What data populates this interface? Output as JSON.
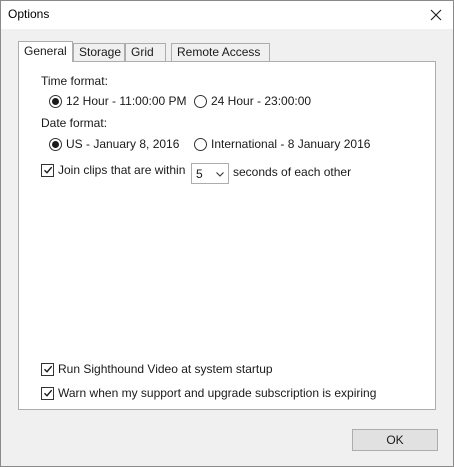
{
  "window": {
    "title": "Options"
  },
  "tabs": [
    {
      "label": "General",
      "active": true
    },
    {
      "label": "Storage",
      "active": false
    },
    {
      "label": "Grid",
      "active": false
    },
    {
      "label": "Remote Access",
      "active": false
    }
  ],
  "general": {
    "time_format": {
      "label": "Time format:",
      "options": [
        {
          "label": "12 Hour - 11:00:00 PM",
          "selected": true
        },
        {
          "label": "24 Hour - 23:00:00",
          "selected": false
        }
      ]
    },
    "date_format": {
      "label": "Date format:",
      "options": [
        {
          "label": "US - January 8, 2016",
          "selected": true
        },
        {
          "label": "International - 8 January 2016",
          "selected": false
        }
      ]
    },
    "join_clips": {
      "label_before": "Join clips that are within",
      "checked": true,
      "seconds_value": "5",
      "label_after": "seconds of each other"
    },
    "startup": {
      "label": "Run Sighthound Video at system startup",
      "checked": true
    },
    "warn_expiring": {
      "label": "Warn when my support and upgrade subscription is expiring",
      "checked": true
    }
  },
  "footer": {
    "ok_label": "OK"
  },
  "icons": {
    "close": "close-icon",
    "dropdown": "chevron-down-icon",
    "check": "checkmark-icon"
  }
}
